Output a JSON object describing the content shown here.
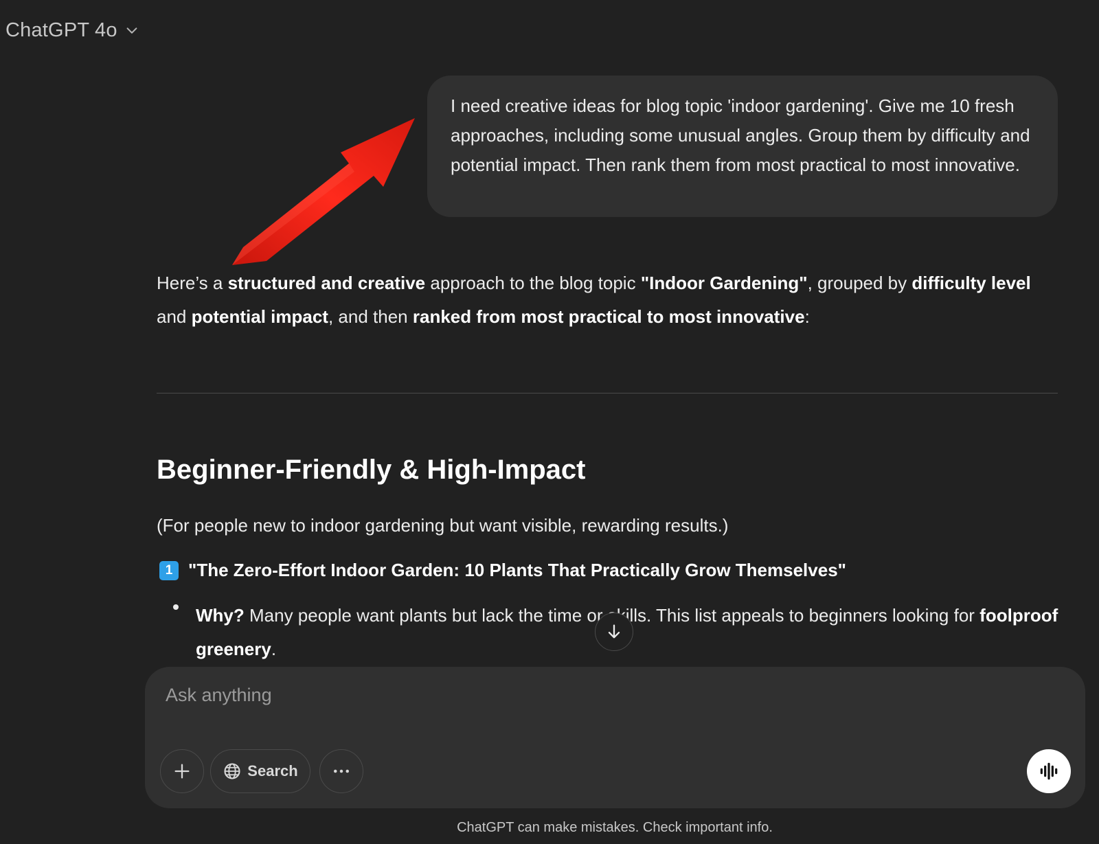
{
  "header": {
    "model_name": "ChatGPT 4o"
  },
  "conversation": {
    "user_message": "I need creative ideas for blog topic 'indoor gardening'. Give me 10 fresh approaches, including some unusual angles. Group them by difficulty and potential impact. Then rank them from most practical to most innovative.",
    "assistant": {
      "intro": {
        "t1": "Here’s a ",
        "b1": "structured and creative",
        "t2": " approach to the blog topic ",
        "b2": "\"Indoor Gardening\"",
        "t3": ", grouped by ",
        "b3": "difficulty level",
        "t4": " and ",
        "b4": "potential impact",
        "t5": ", and then ",
        "b5": "ranked from most practical to most innovative",
        "t6": ":"
      },
      "section_heading": "Beginner-Friendly & High-Impact",
      "section_subtitle": "(For people new to indoor gardening but want visible, rewarding results.)",
      "item1": {
        "number": "1",
        "title": "\"The Zero-Effort Indoor Garden: 10 Plants That Practically Grow Themselves\"",
        "bullet_label": "Why?",
        "bullet_text": " Many people want plants but lack the time or skills. This list appeals to beginners looking for ",
        "bullet_bold": "foolproof greenery",
        "bullet_end": "."
      }
    }
  },
  "composer": {
    "placeholder": "Ask anything",
    "search_label": "Search"
  },
  "footer": {
    "disclaimer": "ChatGPT can make mistakes. Check important info."
  },
  "colors": {
    "background": "#212121",
    "bubble": "#303030",
    "annotation_arrow": "#e8251a",
    "keycap": "#2ea0e8"
  },
  "icons": [
    "chevron-down-icon",
    "arrow-down-icon",
    "plus-icon",
    "globe-icon",
    "more-icon",
    "voice-waveform-icon",
    "keycap-number-icon"
  ]
}
